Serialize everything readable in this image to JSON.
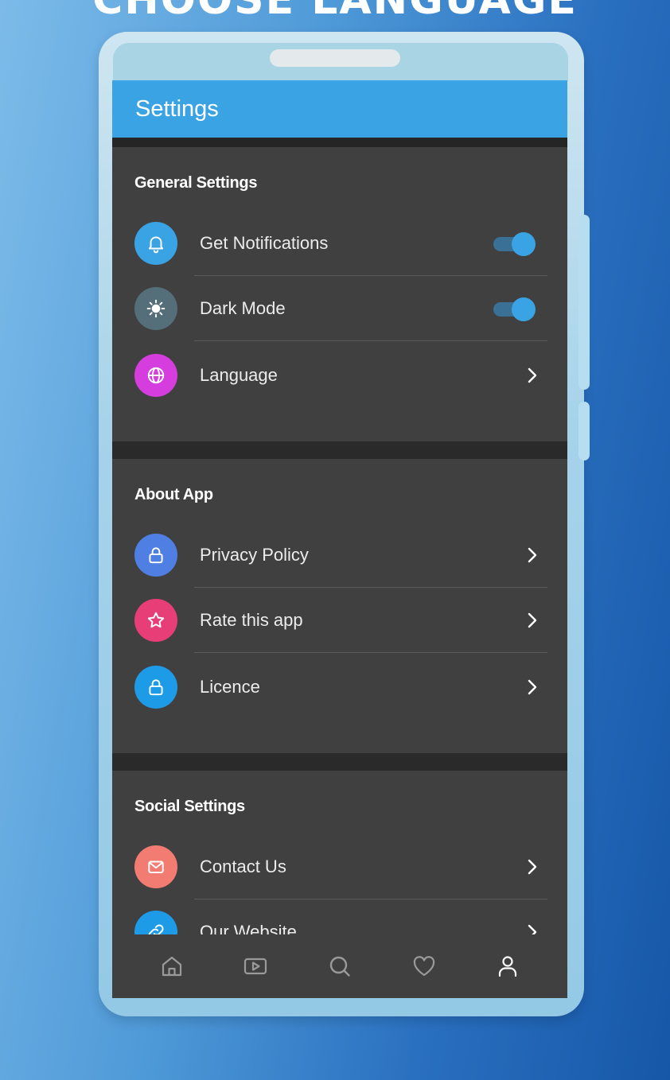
{
  "banner": {
    "text": "CHOOSE LANGUAGE"
  },
  "appbar": {
    "title": "Settings"
  },
  "colors": {
    "accent": "#3aa3e3",
    "notifications_icon_bg": "#3aa3e3",
    "dark_mode_icon_bg": "#546e7a",
    "language_icon_bg": "#d63ddf",
    "privacy_icon_bg": "#4f7fe3",
    "rate_icon_bg": "#e83e78",
    "licence_icon_bg": "#1e9be6",
    "contact_icon_bg": "#f27c72",
    "website_icon_bg": "#1e9be6"
  },
  "sections": {
    "general": {
      "title": "General Settings",
      "items": [
        {
          "label": "Get Notifications",
          "icon": "bell-icon",
          "control": "toggle",
          "enabled": true
        },
        {
          "label": "Dark Mode",
          "icon": "sun-icon",
          "control": "toggle",
          "enabled": true
        },
        {
          "label": "Language",
          "icon": "globe-icon",
          "control": "chevron"
        }
      ]
    },
    "about": {
      "title": "About App",
      "items": [
        {
          "label": "Privacy Policy",
          "icon": "lock-icon",
          "control": "chevron"
        },
        {
          "label": "Rate this app",
          "icon": "star-icon",
          "control": "chevron"
        },
        {
          "label": "Licence",
          "icon": "lock-icon",
          "control": "chevron"
        }
      ]
    },
    "social": {
      "title": "Social Settings",
      "items": [
        {
          "label": "Contact Us",
          "icon": "mail-icon",
          "control": "chevron"
        },
        {
          "label": "Our Website",
          "icon": "link-icon",
          "control": "chevron"
        }
      ]
    }
  },
  "bottom_nav": [
    {
      "icon": "home-icon",
      "active": false
    },
    {
      "icon": "video-icon",
      "active": false
    },
    {
      "icon": "search-icon",
      "active": false
    },
    {
      "icon": "heart-icon",
      "active": false
    },
    {
      "icon": "profile-icon",
      "active": true
    }
  ]
}
